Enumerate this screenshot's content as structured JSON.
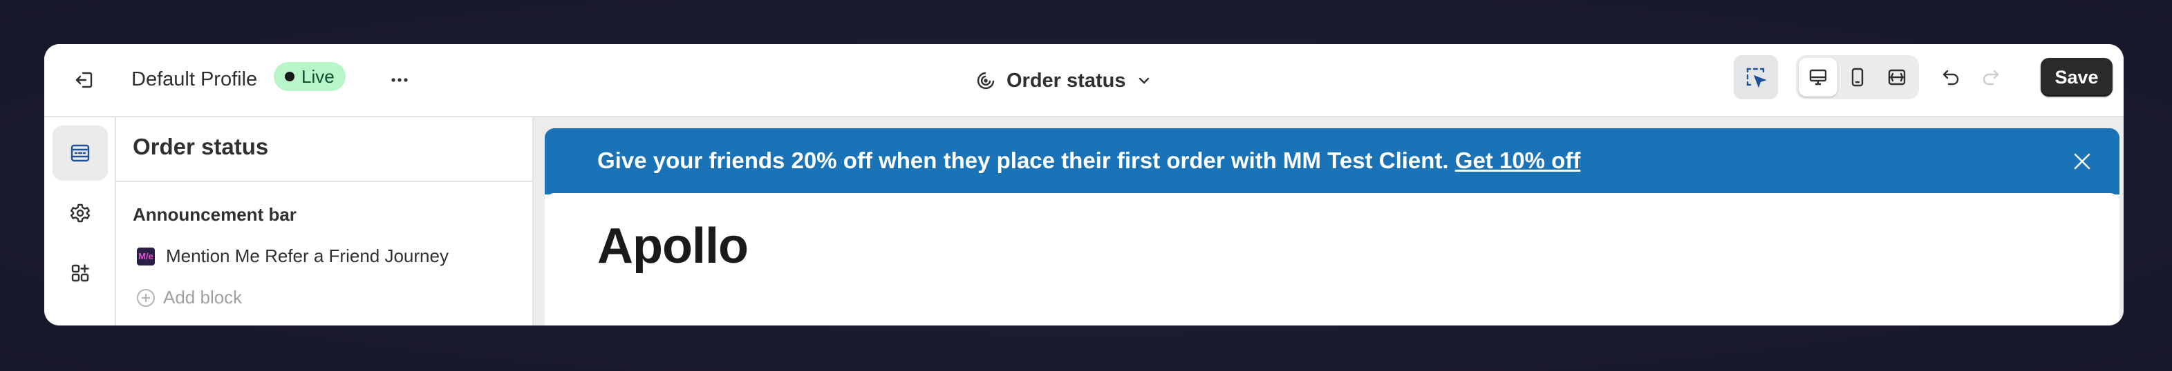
{
  "topbar": {
    "profile_name": "Default Profile",
    "status_badge": "Live",
    "page_selector_label": "Order status",
    "save_label": "Save"
  },
  "sidebar": {
    "title": "Order status",
    "section_title": "Announcement bar",
    "block_label": "Mention Me Refer a Friend Journey",
    "app_icon_text": "M/e",
    "add_block_label": "Add block"
  },
  "preview": {
    "announcement_text": "Give your friends 20% off when they place their first order with MM Test Client.",
    "announcement_link": "Get 10% off",
    "store_name": "Apollo"
  },
  "colors": {
    "announcement_bg": "#1a73b6",
    "live_badge_bg": "#b8f5c9",
    "save_bg": "#2b2b2b"
  },
  "icons": [
    "exit-icon",
    "more-icon",
    "page-type-icon",
    "chevron-down-icon",
    "inspector-icon",
    "desktop-icon",
    "mobile-icon",
    "full-width-icon",
    "undo-icon",
    "redo-icon",
    "sections-icon",
    "settings-icon",
    "apps-icon",
    "close-icon",
    "plus-icon",
    "mention-me-app-icon"
  ]
}
